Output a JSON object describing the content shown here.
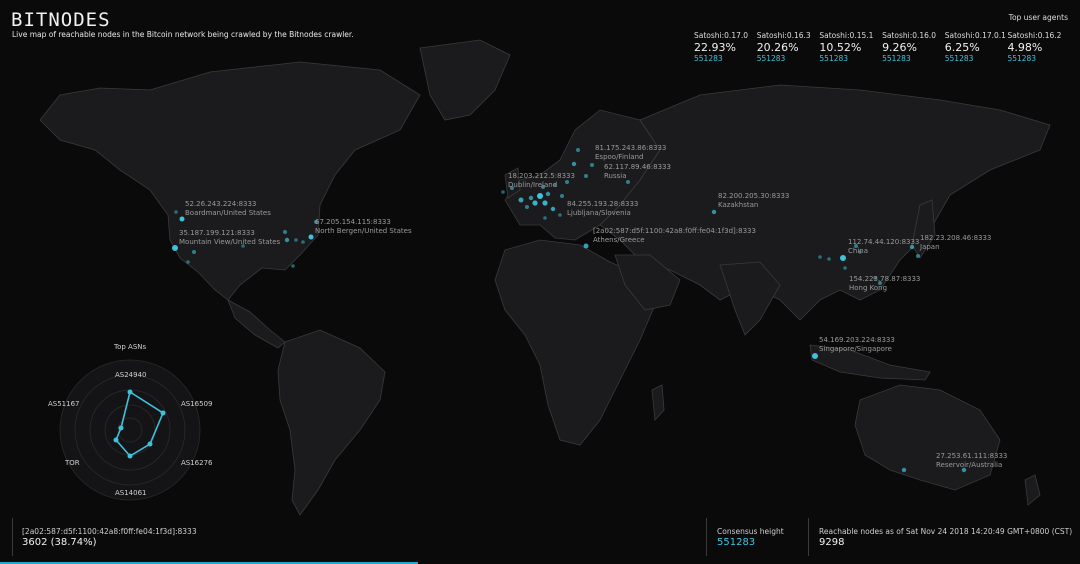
{
  "brand": {
    "logo": "BITNODES",
    "tagline": "Live map of reachable nodes in the Bitcoin network being crawled by the Bitnodes crawler."
  },
  "user_agents": {
    "title": "Top user agents",
    "items": [
      {
        "name": "Satoshi:0.17.0",
        "pct": "22.93%",
        "height": "551283"
      },
      {
        "name": "Satoshi:0.16.3",
        "pct": "20.26%",
        "height": "551283"
      },
      {
        "name": "Satoshi:0.15.1",
        "pct": "10.52%",
        "height": "551283"
      },
      {
        "name": "Satoshi:0.16.0",
        "pct": "9.26%",
        "height": "551283"
      },
      {
        "name": "Satoshi:0.17.0.1",
        "pct": "6.25%",
        "height": "551283"
      },
      {
        "name": "Satoshi:0.16.2",
        "pct": "4.98%",
        "height": "551283"
      }
    ]
  },
  "node_labels": [
    {
      "addr": "81.175.243.86:8333",
      "place": "Espoo/Finland"
    },
    {
      "addr": "62.117.89.46:8333",
      "place": "Russia"
    },
    {
      "addr": "18.203.212.5:8333",
      "place": "Dublin/Ireland"
    },
    {
      "addr": "84.255.193.28:8333",
      "place": "Ljubljana/Slovenia"
    },
    {
      "addr": "[2a02:587:d5f:1100:42a8:f0ff:fe04:1f3d]:8333",
      "place": "Athens/Greece"
    },
    {
      "addr": "82.200.205.30:8333",
      "place": "Kazakhstan"
    },
    {
      "addr": "112.74.44.120:8333",
      "place": "China"
    },
    {
      "addr": "182.23.208.46:8333",
      "place": "Japan"
    },
    {
      "addr": "154.223.78.87:8333",
      "place": "Hong Kong"
    },
    {
      "addr": "54.169.203.224:8333",
      "place": "Singapore/Singapore"
    },
    {
      "addr": "27.253.61.111:8333",
      "place": "Reservoir/Australia"
    },
    {
      "addr": "52.26.243.224:8333",
      "place": "Boardman/United States"
    },
    {
      "addr": "35.187.199.121:8333",
      "place": "Mountain View/United States"
    },
    {
      "addr": "67.205.154.115:8333",
      "place": "North Bergen/United States"
    }
  ],
  "asn": {
    "title": "Top ASNs",
    "labels": [
      "AS24940",
      "AS16509",
      "AS16276",
      "AS14061",
      "TOR",
      "AS51167"
    ]
  },
  "selected_node": {
    "addr": "[2a02:587:d5f:1100:42a8:f0ff:fe04:1f3d]:8333",
    "value": "3602 (38.74%)",
    "progress": 0.3874
  },
  "consensus": {
    "label": "Consensus height",
    "value": "551283"
  },
  "reachable": {
    "label": "Reachable nodes as of Sat Nov 24 2018 14:20:49 GMT+0800 (CST)",
    "value": "9298"
  },
  "colors": {
    "accent": "#3ec3dc",
    "background": "#0a0a0b",
    "land": "#1c1c1e",
    "border": "#3a3a3c"
  }
}
